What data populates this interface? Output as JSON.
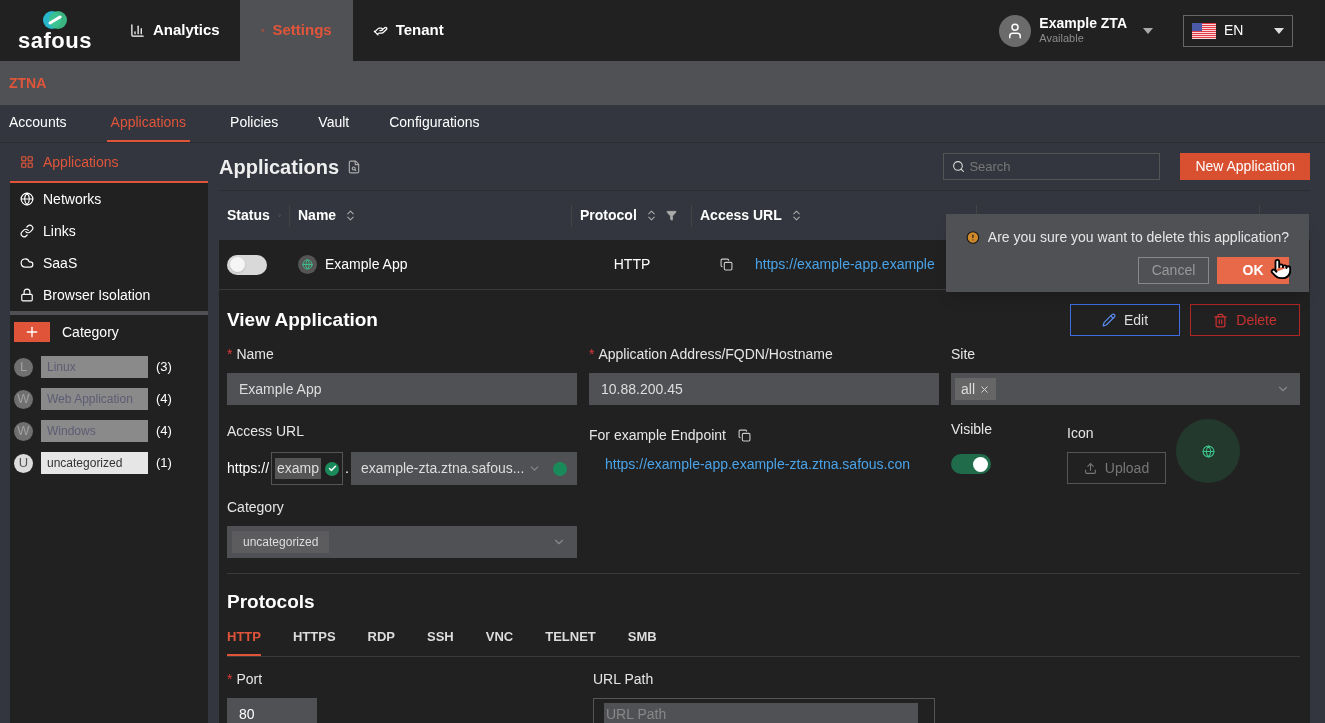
{
  "brand": {
    "name": "safous"
  },
  "top_nav": [
    {
      "label": "Analytics",
      "selected": false
    },
    {
      "label": "Settings",
      "selected": true
    },
    {
      "label": "Tenant",
      "selected": false
    }
  ],
  "user": {
    "name": "Example ZTA",
    "status": "Available"
  },
  "language": {
    "code": "EN"
  },
  "section_title": "ZTNA",
  "sub_tabs": [
    {
      "label": "Accounts",
      "selected": false
    },
    {
      "label": "Applications",
      "selected": true
    },
    {
      "label": "Policies",
      "selected": false
    },
    {
      "label": "Vault",
      "selected": false
    },
    {
      "label": "Configurations",
      "selected": false
    }
  ],
  "sidebar": {
    "items": [
      {
        "label": "Applications",
        "selected": true
      },
      {
        "label": "Networks",
        "selected": false
      },
      {
        "label": "Links",
        "selected": false
      },
      {
        "label": "SaaS",
        "selected": false
      },
      {
        "label": "Browser Isolation",
        "selected": false
      }
    ],
    "category_header": "Category",
    "categories": [
      {
        "initial": "L",
        "name": "Linux",
        "count": "(3)",
        "selected": false
      },
      {
        "initial": "W",
        "name": "Web Application",
        "count": "(4)",
        "selected": false
      },
      {
        "initial": "W",
        "name": "Windows",
        "count": "(4)",
        "selected": false
      },
      {
        "initial": "U",
        "name": "uncategorized",
        "count": "(1)",
        "selected": true
      }
    ]
  },
  "page": {
    "title": "Applications",
    "search_placeholder": "Search",
    "new_button": "New Application"
  },
  "table": {
    "columns": [
      {
        "label": "Status",
        "filtered": false
      },
      {
        "label": "Name",
        "filtered": false
      },
      {
        "label": "Protocol",
        "filtered": true
      },
      {
        "label": "Access URL",
        "filtered": false
      }
    ],
    "rows": [
      {
        "enabled": false,
        "name": "Example App",
        "protocol": "HTTP",
        "access_url": "https://example-app.example"
      }
    ]
  },
  "confirm": {
    "message": "Are you sure you want to delete this application?",
    "cancel": "Cancel",
    "ok": "OK"
  },
  "view": {
    "title": "View Application",
    "edit": "Edit",
    "delete": "Delete",
    "name": {
      "label": "Name",
      "required_mark": "*",
      "value": "Example App"
    },
    "address": {
      "label": "Application Address/FQDN/Hostname",
      "required_mark": "*",
      "value": "10.88.200.45"
    },
    "site": {
      "label": "Site",
      "tags": [
        "all"
      ]
    },
    "access_url": {
      "label": "Access URL",
      "prefix": "https://",
      "subdomain": "examp",
      "separator": ".",
      "domain": "example-zta.ztna.safous..."
    },
    "endpoint": {
      "label": "For example Endpoint",
      "url": "https://example-app.example-zta.ztna.safous.con"
    },
    "visible": {
      "label": "Visible",
      "on": true
    },
    "icon": {
      "label": "Icon",
      "upload": "Upload"
    },
    "category": {
      "label": "Category",
      "tag": "uncategorized"
    },
    "protocols_title": "Protocols",
    "protocol_tabs": [
      {
        "label": "HTTP",
        "selected": true
      },
      {
        "label": "HTTPS",
        "selected": false
      },
      {
        "label": "RDP",
        "selected": false
      },
      {
        "label": "SSH",
        "selected": false
      },
      {
        "label": "VNC",
        "selected": false
      },
      {
        "label": "TELNET",
        "selected": false
      },
      {
        "label": "SMB",
        "selected": false
      }
    ],
    "port": {
      "label": "Port",
      "required_mark": "*",
      "value": "80"
    },
    "url_path": {
      "label": "URL Path",
      "placeholder": "URL Path"
    }
  }
}
